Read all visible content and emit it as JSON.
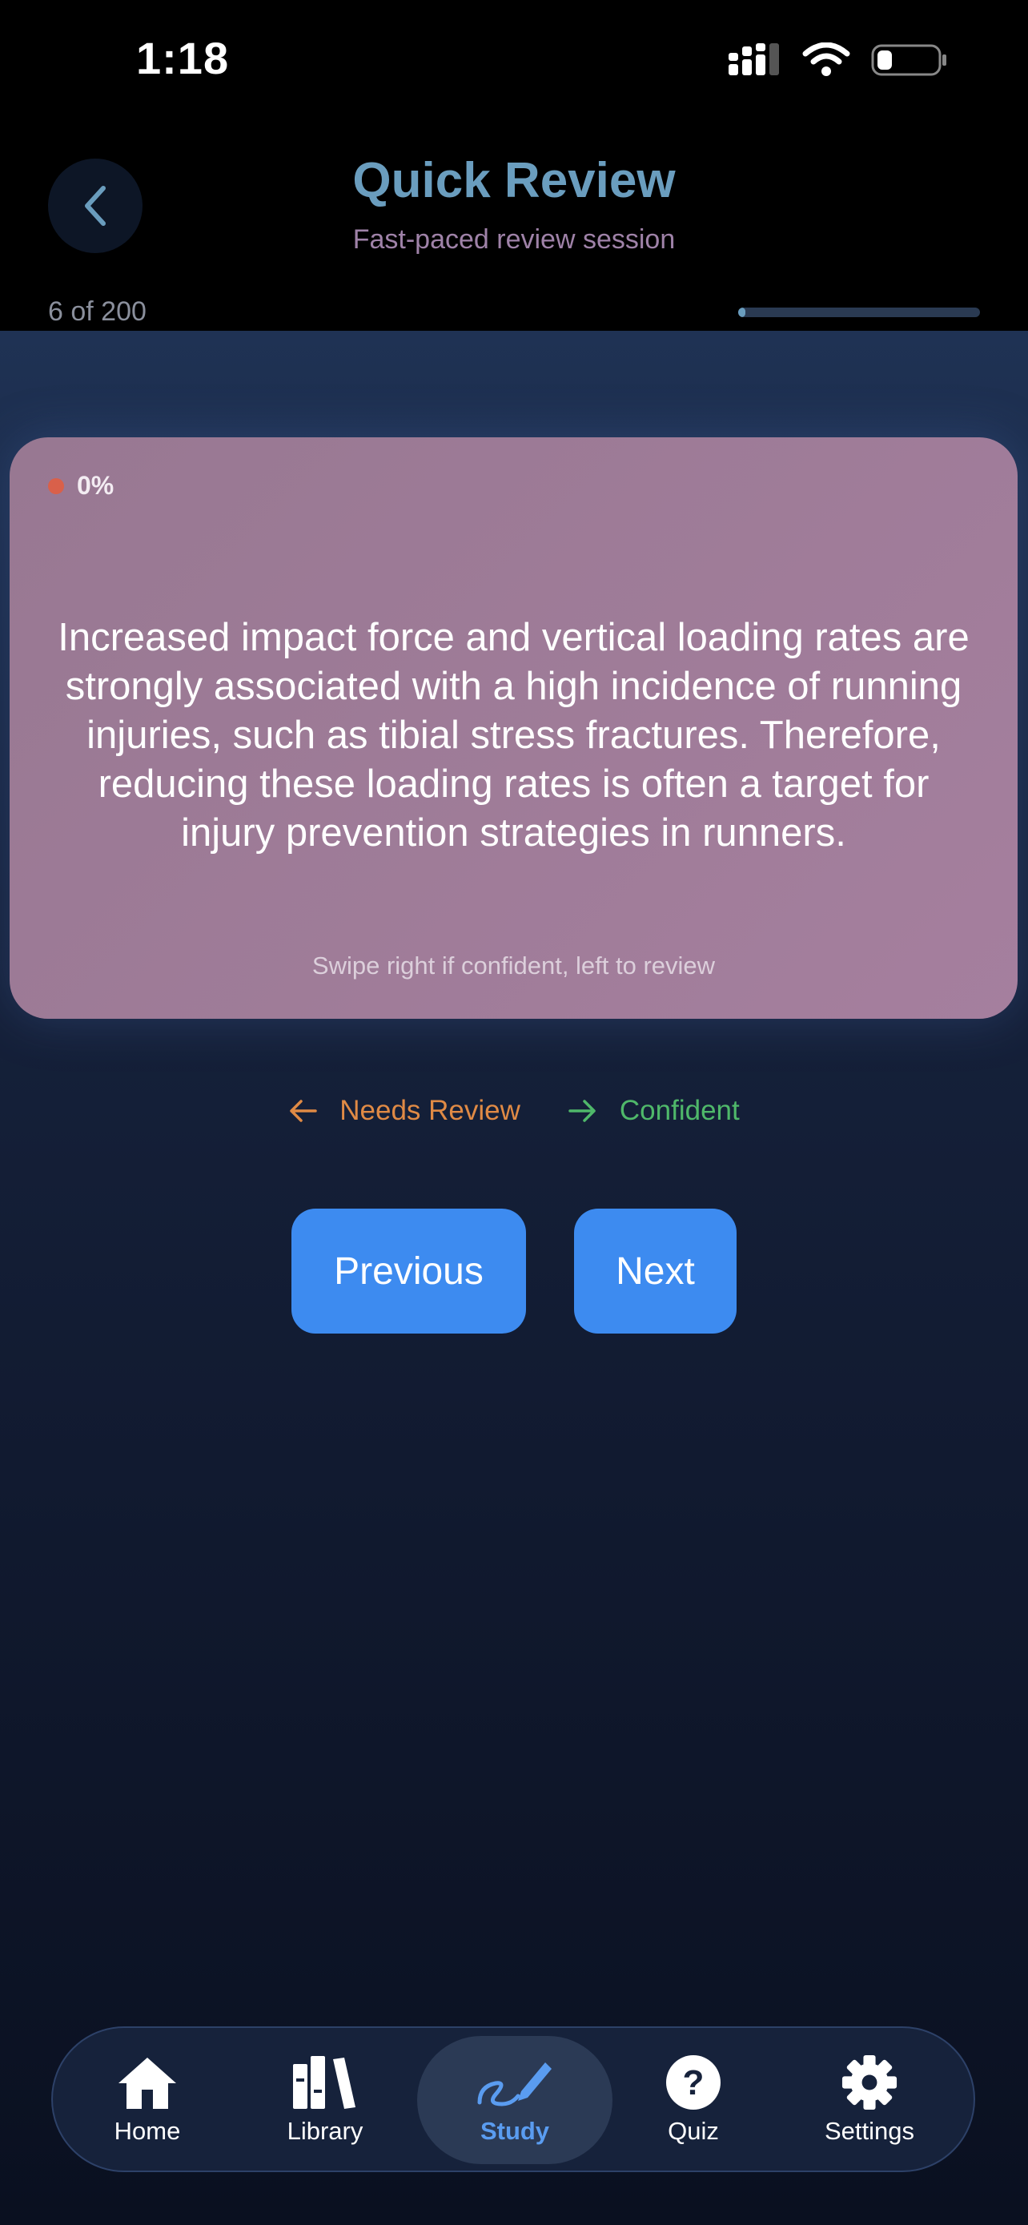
{
  "status_bar": {
    "time": "1:18",
    "battery_level": 0.25
  },
  "header": {
    "title": "Quick Review",
    "subtitle": "Fast-paced review session",
    "counter": "6 of 200",
    "progress": 0.03
  },
  "card": {
    "score": "0%",
    "text": "Increased impact force and vertical loading rates are strongly associated with a high incidence of running injuries, such as tibial stress fractures. Therefore, reducing these loading rates is often a target for injury prevention strategies in runners.",
    "hint": "Swipe right if confident, left to review"
  },
  "swipe": {
    "needs_review": "Needs Review",
    "confident": "Confident"
  },
  "buttons": {
    "previous": "Previous",
    "next": "Next"
  },
  "tabs": [
    {
      "label": "Home",
      "icon": "home-icon"
    },
    {
      "label": "Library",
      "icon": "library-icon"
    },
    {
      "label": "Study",
      "icon": "pencil-icon",
      "active": true
    },
    {
      "label": "Quiz",
      "icon": "question-icon"
    },
    {
      "label": "Settings",
      "icon": "gear-icon"
    }
  ],
  "colors": {
    "accent": "#3d8bf0",
    "title": "#6a9dbe",
    "card": "#a07c98",
    "review": "#e08a45",
    "confident": "#4fb86a",
    "active_tab": "#5a9cf0"
  }
}
